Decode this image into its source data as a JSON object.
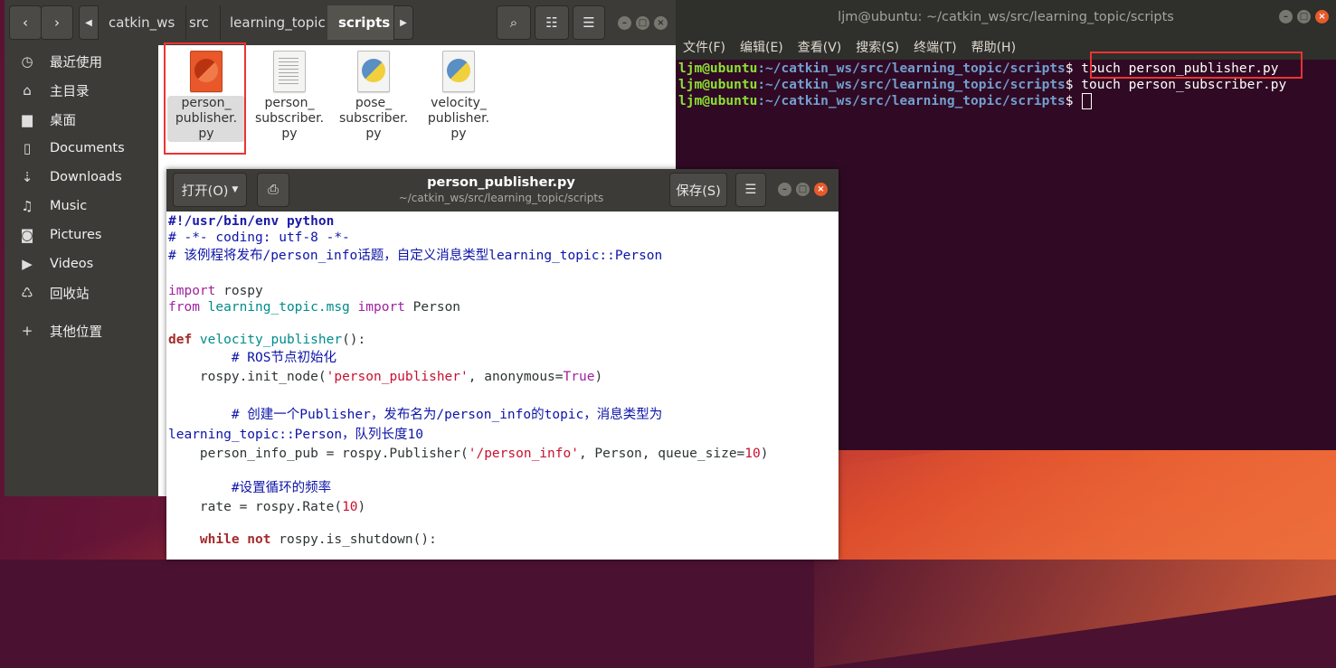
{
  "terminal": {
    "title": "ljm@ubuntu: ~/catkin_ws/src/learning_topic/scripts",
    "menu": [
      "文件(F)",
      "编辑(E)",
      "查看(V)",
      "搜索(S)",
      "终端(T)",
      "帮助(H)"
    ],
    "lines": [
      {
        "user": "ljm@ubuntu",
        "path": ":~/catkin_ws/src/learning_topic/scripts",
        "sym": "$ ",
        "cmd": "touch person_publisher.py"
      },
      {
        "user": "ljm@ubuntu",
        "path": ":~/catkin_ws/src/learning_topic/scripts",
        "sym": "$ ",
        "cmd": "touch person_subscriber.py"
      },
      {
        "user": "ljm@ubuntu",
        "path": ":~/catkin_ws/src/learning_topic/scripts",
        "sym": "$ ",
        "cmd": ""
      }
    ]
  },
  "files": {
    "breadcrumbs": [
      "catkin_ws",
      "src",
      "learning_topic",
      "scripts"
    ],
    "sidebar": [
      {
        "icon": "clock-icon",
        "glyph": "◷",
        "label": "最近使用"
      },
      {
        "icon": "home-icon",
        "glyph": "⌂",
        "label": "主目录"
      },
      {
        "icon": "folder-icon",
        "glyph": "▆",
        "label": "桌面"
      },
      {
        "icon": "document-icon",
        "glyph": "▯",
        "label": "Documents"
      },
      {
        "icon": "download-icon",
        "glyph": "⇣",
        "label": "Downloads"
      },
      {
        "icon": "music-icon",
        "glyph": "♫",
        "label": "Music"
      },
      {
        "icon": "camera-icon",
        "glyph": "◙",
        "label": "Pictures"
      },
      {
        "icon": "video-icon",
        "glyph": "▶",
        "label": "Videos"
      },
      {
        "icon": "trash-icon",
        "glyph": "♺",
        "label": "回收站"
      },
      {
        "icon": "plus-icon",
        "glyph": "+",
        "label": "其他位置"
      }
    ],
    "items": [
      {
        "name1": "person_",
        "name2": "publisher.",
        "name3": "py"
      },
      {
        "name1": "person_",
        "name2": "subscriber.",
        "name3": "py"
      },
      {
        "name1": "pose_",
        "name2": "subscriber.",
        "name3": "py"
      },
      {
        "name1": "velocity_",
        "name2": "publisher.",
        "name3": "py"
      }
    ]
  },
  "gedit": {
    "open_label": "打开(O)",
    "title": "person_publisher.py",
    "subtitle": "~/catkin_ws/src/learning_topic/scripts",
    "save_label": "保存(S)",
    "code": {
      "l1": "#!/usr/bin/env python",
      "l2": "# -*- coding: utf-8 -*-",
      "l3": "# 该例程将发布/person_info话题，自定义消息类型learning_topic::Person",
      "l4a": "import",
      "l4b": " rospy",
      "l5a": "from",
      "l5b": " learning_topic.msg ",
      "l5c": "import",
      "l5d": " Person",
      "l6a": "def",
      "l6b": " velocity_publisher",
      "l6c": "():",
      "l7": "        # ROS节点初始化",
      "l8a": "    rospy.init_node(",
      "l8b": "'person_publisher'",
      "l8c": ", anonymous=",
      "l8d": "True",
      "l8e": ")",
      "l9": "        # 创建一个Publisher，发布名为/person_info的topic，消息类型为",
      "l10": "learning_topic::Person，队列长度10",
      "l11a": "    person_info_pub = rospy.Publisher(",
      "l11b": "'/person_info'",
      "l11c": ", Person, queue_size=",
      "l11d": "10",
      "l11e": ")",
      "l12": "        #设置循环的频率",
      "l13a": "    rate = rospy.Rate(",
      "l13b": "10",
      "l13c": ")",
      "l14a": "    while",
      "l14b": " not",
      "l14c": " rospy.is_shutdown():"
    }
  }
}
